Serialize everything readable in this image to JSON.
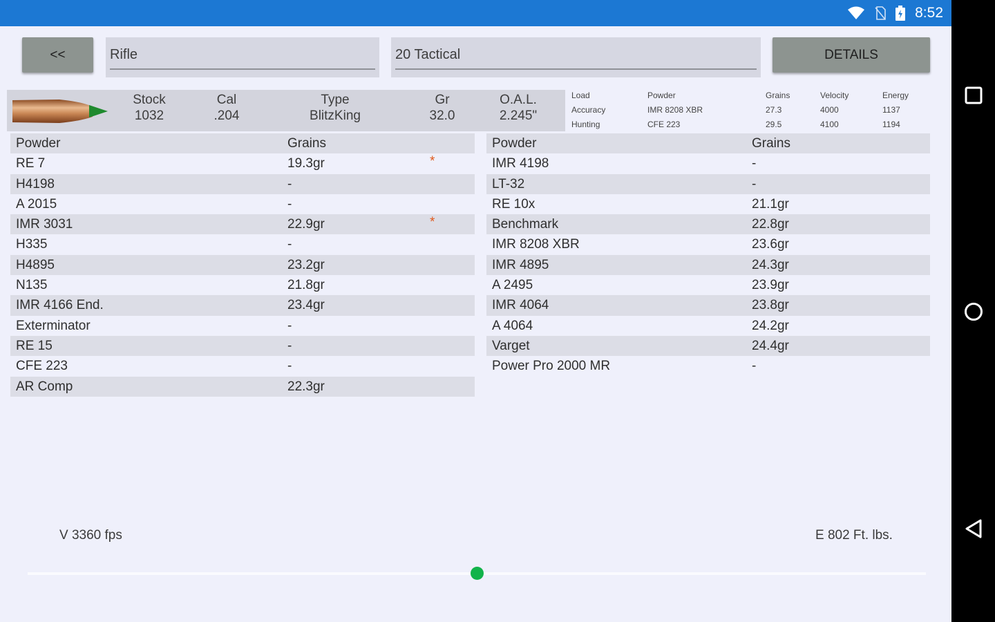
{
  "status": {
    "time": "8:52"
  },
  "toolbar": {
    "back_label": "<<",
    "category_value": "Rifle",
    "cartridge_value": "20 Tactical",
    "details_label": "DETAILS"
  },
  "bullet_info": {
    "stock_label": "Stock",
    "stock_value": "1032",
    "cal_label": "Cal",
    "cal_value": ".204",
    "type_label": "Type",
    "type_value": "BlitzKing",
    "gr_label": "Gr",
    "gr_value": "32.0",
    "oal_label": "O.A.L.",
    "oal_value": "2.245\""
  },
  "loads": {
    "headers": {
      "load": "Load",
      "powder": "Powder",
      "grains": "Grains",
      "velocity": "Velocity",
      "energy": "Energy"
    },
    "rows": [
      {
        "load": "Accuracy",
        "powder": "IMR 8208 XBR",
        "grains": "27.3",
        "velocity": "4000",
        "energy": "1137"
      },
      {
        "load": "Hunting",
        "powder": "CFE 223",
        "grains": "29.5",
        "velocity": "4100",
        "energy": "1194"
      }
    ]
  },
  "left_table": {
    "header": {
      "powder": "Powder",
      "grains": "Grains"
    },
    "rows": [
      {
        "powder": "RE 7",
        "grains": "19.3gr",
        "mark": "*"
      },
      {
        "powder": "H4198",
        "grains": "-",
        "mark": ""
      },
      {
        "powder": "A 2015",
        "grains": "-",
        "mark": ""
      },
      {
        "powder": "IMR 3031",
        "grains": "22.9gr",
        "mark": "*"
      },
      {
        "powder": "H335",
        "grains": "-",
        "mark": ""
      },
      {
        "powder": "H4895",
        "grains": "23.2gr",
        "mark": ""
      },
      {
        "powder": "N135",
        "grains": "21.8gr",
        "mark": ""
      },
      {
        "powder": "IMR 4166 End.",
        "grains": "23.4gr",
        "mark": ""
      },
      {
        "powder": "Exterminator",
        "grains": "-",
        "mark": ""
      },
      {
        "powder": "RE 15",
        "grains": "-",
        "mark": ""
      },
      {
        "powder": "CFE 223",
        "grains": "-",
        "mark": ""
      },
      {
        "powder": "AR Comp",
        "grains": "22.3gr",
        "mark": ""
      }
    ]
  },
  "right_table": {
    "header": {
      "powder": "Powder",
      "grains": "Grains"
    },
    "rows": [
      {
        "powder": "IMR 4198",
        "grains": "-"
      },
      {
        "powder": "LT-32",
        "grains": "-"
      },
      {
        "powder": "RE 10x",
        "grains": "21.1gr"
      },
      {
        "powder": "Benchmark",
        "grains": "22.8gr"
      },
      {
        "powder": "IMR 8208 XBR",
        "grains": "23.6gr"
      },
      {
        "powder": "IMR 4895",
        "grains": "24.3gr"
      },
      {
        "powder": "A 2495",
        "grains": "23.9gr"
      },
      {
        "powder": "IMR 4064",
        "grains": "23.8gr"
      },
      {
        "powder": "A 4064",
        "grains": "24.2gr"
      },
      {
        "powder": "Varget",
        "grains": "24.4gr"
      },
      {
        "powder": "Power Pro 2000 MR",
        "grains": "-"
      }
    ]
  },
  "footer": {
    "velocity_label": "V 3360 fps",
    "energy_label": "E 802 Ft. lbs.",
    "slider_fraction": 0.5
  },
  "colors": {
    "statusbar": "#1c78d3",
    "slider_thumb": "#12b34a",
    "mark": "#e05a1e"
  },
  "icons": [
    "wifi-icon",
    "no-sim-icon",
    "battery-icon",
    "recents-icon",
    "home-icon",
    "back-icon"
  ]
}
